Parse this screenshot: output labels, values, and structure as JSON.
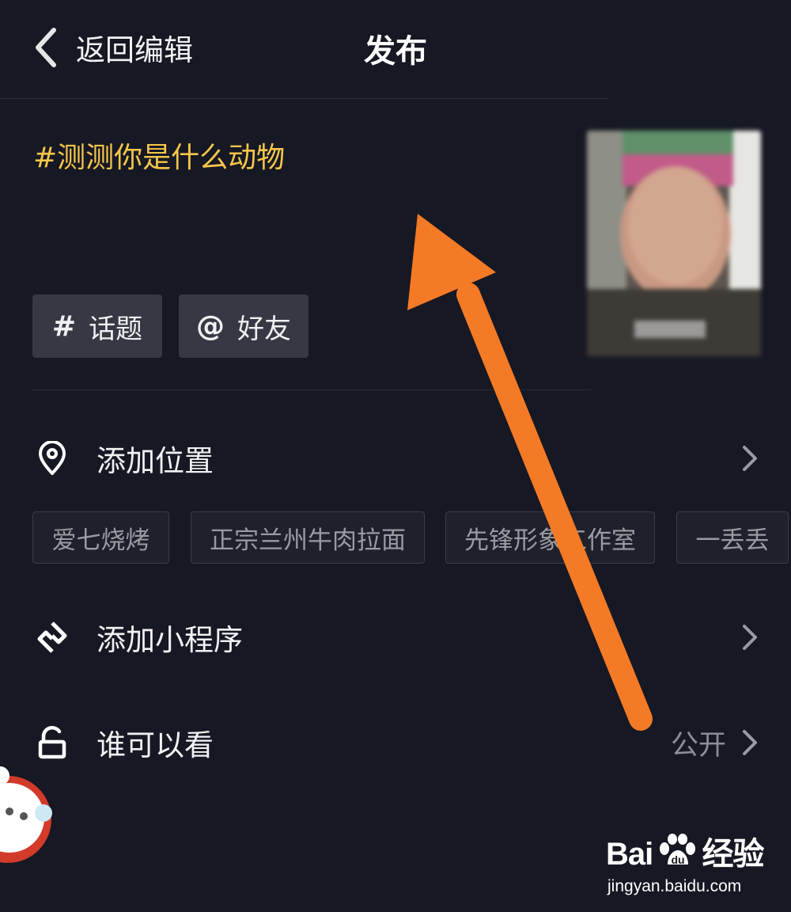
{
  "header": {
    "back_label": "返回编辑",
    "title": "发布"
  },
  "caption": "#测测你是什么动物",
  "tags": {
    "topic_symbol": "#",
    "topic_label": "话题",
    "friend_symbol": "@",
    "friend_label": "好友"
  },
  "location": {
    "label": "添加位置",
    "chips": [
      "爱七烧烤",
      "正宗兰州牛肉拉面",
      "先锋形象工作室",
      "一丢丢"
    ]
  },
  "mini_program": {
    "label": "添加小程序"
  },
  "visibility": {
    "label": "谁可以看",
    "value": "公开"
  },
  "watermark": {
    "brand": "Bai",
    "brand_tail": "经验",
    "url": "jingyan.baidu.com"
  },
  "colors": {
    "background": "#161823",
    "caption": "#f5c64a",
    "arrow": "#f57a25",
    "tag_bg": "#363844"
  },
  "icons": [
    "chevron-left-icon",
    "location-pin-icon",
    "mini-program-icon",
    "unlock-icon",
    "chevron-right-icon"
  ]
}
